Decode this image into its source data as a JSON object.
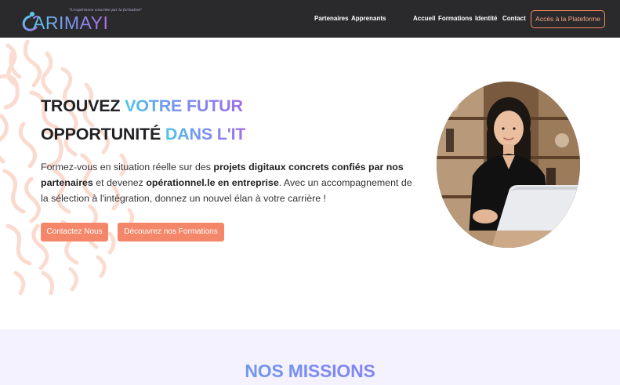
{
  "brand": {
    "name": "ARIMAYI",
    "tagline": "\"L'expérience concrète par la formation\"",
    "accent_color": "#f4876a",
    "gradient": [
      "#4fc3e8",
      "#7b8cf2",
      "#9d70e8"
    ],
    "nav_bg": "#2a2a2c"
  },
  "nav": {
    "left_links": [
      "Partenaires",
      "Apprenants"
    ],
    "right_links": [
      "Accueil",
      "Formations",
      "Identité",
      "Contact"
    ],
    "cta": "Accès à la Plateforme"
  },
  "hero": {
    "title_line1_dark": "TROUVEZ",
    "title_line1_grad": "VOTRE FUTUR",
    "title_line2_dark": "OPPORTUNITÉ",
    "title_line2_grad": "DANS L'IT",
    "text_1": "Formez-vous en situation réelle sur des ",
    "text_bold_1": "projets digitaux concrets confiés par nos partenaires",
    "text_2": " et devenez ",
    "text_bold_2": "opérationnel.le en entreprise",
    "text_3": ". Avec un accompagnement de la sélection à l'intégration, donnez un nouvel élan à votre carrière !",
    "btn_contact": "Contactez Nous",
    "btn_formations": "Découvrez nos Formations",
    "photo_icon": "portrait-photo"
  },
  "missions": {
    "title": "NOS MISSIONS"
  }
}
